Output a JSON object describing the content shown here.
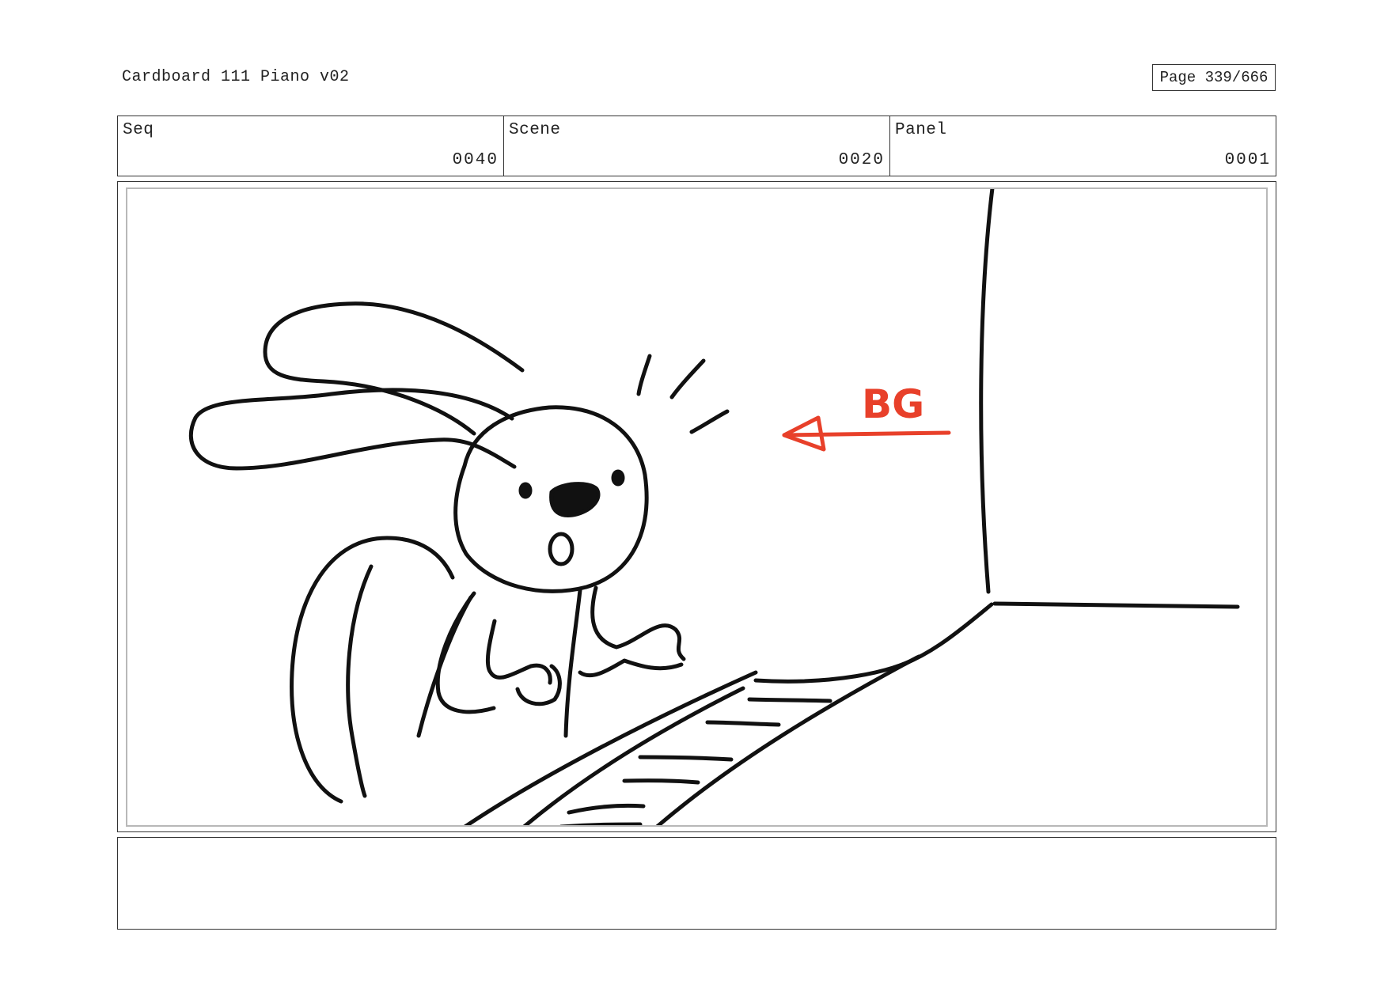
{
  "header": {
    "title": "Cardboard 111 Piano v02",
    "page": "Page 339/666"
  },
  "meta": {
    "seq_label": "Seq",
    "seq_value": "0040",
    "scene_label": "Scene",
    "scene_value": "0020",
    "panel_label": "Panel",
    "panel_value": "0001"
  },
  "panel": {
    "annotation_label": "BG",
    "annotation_color": "#e8402a",
    "ink_color": "#111111"
  },
  "notes": {
    "text": ""
  }
}
